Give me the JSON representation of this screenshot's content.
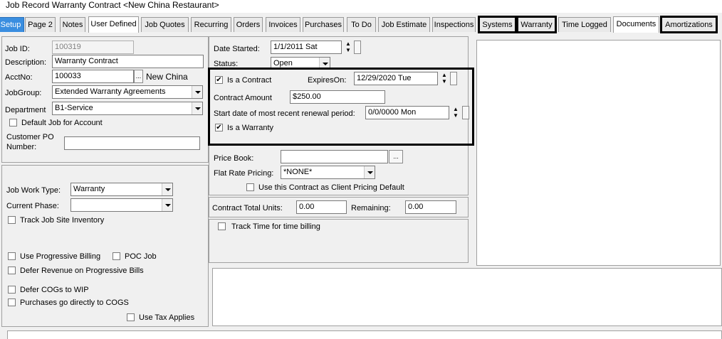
{
  "window": {
    "title": "Job Record Warranty Contract <New China Restaurant>"
  },
  "tabs": [
    {
      "label": "Setup"
    },
    {
      "label": "Page 2"
    },
    {
      "label": "Notes"
    },
    {
      "label": "User Defined"
    },
    {
      "label": "Job Quotes"
    },
    {
      "label": "Recurring"
    },
    {
      "label": "Orders"
    },
    {
      "label": "Invoices"
    },
    {
      "label": "Purchases"
    },
    {
      "label": "To Do"
    },
    {
      "label": "Job Estimate"
    },
    {
      "label": "Inspections"
    },
    {
      "label": "Systems"
    },
    {
      "label": "Warranty"
    },
    {
      "label": "Time Logged"
    },
    {
      "label": "Documents"
    },
    {
      "label": "Amortizations"
    }
  ],
  "left": {
    "job_id_label": "Job ID:",
    "job_id": "100319",
    "description_label": "Description:",
    "description": "Warranty Contract",
    "acctno_label": "AcctNo:",
    "acctno": "100033",
    "acct_browse": "...",
    "acct_name": "New China",
    "jobgroup_label": "JobGroup:",
    "jobgroup": "Extended Warranty Agreements",
    "department_label": "Department",
    "department": "B1-Service",
    "default_job_label": "Default Job for Account",
    "customer_po_label": "Customer PO Number:",
    "customer_po": ""
  },
  "left_lower": {
    "work_type_label": "Job Work Type:",
    "work_type": "Warranty",
    "current_phase_label": "Current Phase:",
    "current_phase": "",
    "track_inventory_label": "Track Job Site Inventory",
    "progressive_billing_label": "Use Progressive Billing",
    "poc_job_label": "POC Job",
    "defer_revenue_label": "Defer Revenue on Progressive Bills",
    "defer_cogs_label": "Defer COGs to WIP",
    "purchases_cogs_label": "Purchases go directly to COGS",
    "use_tax_label": "Use Tax Applies"
  },
  "middle": {
    "date_started_label": "Date Started:",
    "date_started": "1/1/2011 Sat",
    "status_label": "Status:",
    "status": "Open",
    "is_contract_label": "Is a Contract",
    "expires_label": "ExpiresOn:",
    "expires": "12/29/2020 Tue",
    "contract_amount_label": "Contract Amount",
    "contract_amount": "$250.00",
    "renewal_label": "Start date of most recent renewal period:",
    "renewal": "0/0/0000 Mon",
    "is_warranty_label": "Is a Warranty",
    "price_book_label": "Price Book:",
    "price_book": "",
    "price_book_browse": "...",
    "flat_rate_label": "Flat Rate Pricing:",
    "flat_rate": "*NONE*",
    "client_pricing_label": "Use this Contract as Client Pricing Default",
    "contract_units_label": "Contract Total Units:",
    "contract_units": "0.00",
    "remaining_label": "Remaining:",
    "remaining": "0.00",
    "track_time_label": "Track Time for time billing"
  },
  "checkboxes": {
    "default_job": false,
    "is_contract": true,
    "is_warranty": true,
    "client_pricing": false,
    "track_time": false,
    "track_inventory": false,
    "progressive_billing": false,
    "poc_job": false,
    "defer_revenue": false,
    "defer_cogs": false,
    "purchases_cogs": false,
    "use_tax": false
  },
  "colors": {
    "accent_tab": "#3a8ee0",
    "highlight": "#000000"
  }
}
